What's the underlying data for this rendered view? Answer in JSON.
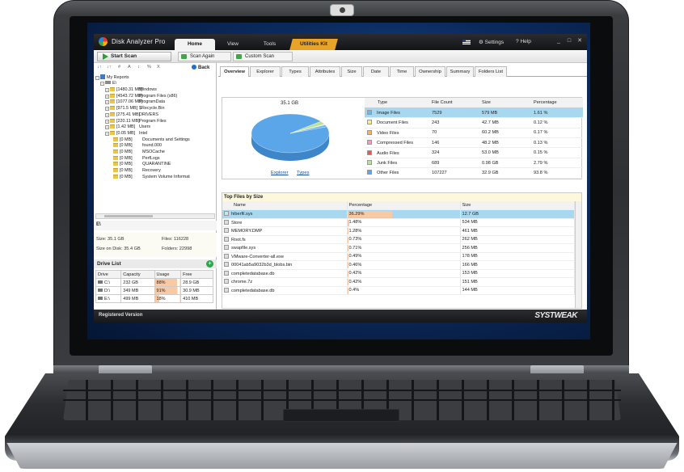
{
  "app": {
    "title": "Disk Analyzer Pro",
    "menu_tabs": [
      "Home",
      "View",
      "Tools",
      "Utilities Kit"
    ],
    "settings_label": "Settings",
    "help_label": "Help",
    "window_buttons": [
      "_",
      "□",
      "✕"
    ]
  },
  "toolbar": {
    "start_scan": "Start Scan",
    "scan_again": "Scan Again",
    "custom_scan": "Custom Scan"
  },
  "left": {
    "tools": [
      "↓↑",
      "↓↑",
      "#",
      "A",
      "↕",
      "%",
      "X"
    ],
    "back_label": "Back",
    "root_label": "My Reports",
    "root_drive": "E\\",
    "tree": [
      {
        "size": "[1480.31 MB]",
        "name": "Windows"
      },
      {
        "size": "[4543.72 MB]",
        "name": "Program Files (x86)"
      },
      {
        "size": "[1077.06 MB]",
        "name": "ProgramData"
      },
      {
        "size": "[971.5 MB]",
        "name": "$Recycle.Bin"
      },
      {
        "size": "[275.41 MB]",
        "name": "DRIVERS"
      },
      {
        "size": "[220.11 MB]",
        "name": "Program Files"
      },
      {
        "size": "[1.42 MB]",
        "name": "Users"
      },
      {
        "size": "[0.05 MB]",
        "name": "Intel"
      },
      {
        "size": "[0 MB]",
        "name": "Documents and Settings"
      },
      {
        "size": "[0 MB]",
        "name": "found.000"
      },
      {
        "size": "[0 MB]",
        "name": "MSOCache"
      },
      {
        "size": "[0 MB]",
        "name": "PerfLogs"
      },
      {
        "size": "[0 MB]",
        "name": "QUARANTINE"
      },
      {
        "size": "[0 MB]",
        "name": "Recovery"
      },
      {
        "size": "[0 MB]",
        "name": "System Volume Informat"
      }
    ],
    "path": "E\\",
    "size": "Size: 35.1 GB",
    "files": "Files: 116228",
    "size_on_disk": "Size on Disk: 35.4 GB",
    "folders": "Folders: 22998",
    "drive_list_title": "Drive List",
    "drive_headers": [
      "Drive",
      "Capacity",
      "Usage",
      "Free"
    ],
    "drives": [
      {
        "drive": "C:\\",
        "capacity": "232 GB",
        "usage": "88%",
        "usage_pct": 88,
        "free": "28.9 GB"
      },
      {
        "drive": "D:\\",
        "capacity": "349 MB",
        "usage": "91%",
        "usage_pct": 91,
        "free": "30.9 MB"
      },
      {
        "drive": "E:\\",
        "capacity": "499 MB",
        "usage": "18%",
        "usage_pct": 18,
        "free": "410 MB"
      }
    ]
  },
  "right": {
    "tabs": [
      "Overview",
      "Explorer",
      "Types",
      "Attributes",
      "Size",
      "Date",
      "Time",
      "Ownership",
      "Summary",
      "Folders List"
    ],
    "pie_total": "35.1 GB",
    "links": [
      "Explorer",
      "Types"
    ],
    "type_headers": [
      "Type",
      "File Count",
      "Size",
      "Percentage"
    ],
    "types": [
      {
        "type": "Image Files",
        "count": "7529",
        "size": "579 MB",
        "pct": "1.61 %",
        "pct_value": 1.61,
        "color": "#6fb6e6"
      },
      {
        "type": "Document Files",
        "count": "243",
        "size": "42.7 MB",
        "pct": "0.12 %",
        "pct_value": 0.12,
        "color": "#f3ee8c"
      },
      {
        "type": "Video Files",
        "count": "70",
        "size": "60.2 MB",
        "pct": "0.17 %",
        "pct_value": 0.17,
        "color": "#f4b55a"
      },
      {
        "type": "Compressed Files",
        "count": "146",
        "size": "48.2 MB",
        "pct": "0.13 %",
        "pct_value": 0.13,
        "color": "#f29ac0"
      },
      {
        "type": "Audio Files",
        "count": "324",
        "size": "53.0 MB",
        "pct": "0.15 %",
        "pct_value": 0.15,
        "color": "#e85656"
      },
      {
        "type": "Junk Files",
        "count": "689",
        "size": "0.98 GB",
        "pct": "2.79 %",
        "pct_value": 2.79,
        "color": "#b9e29a"
      },
      {
        "type": "Other Files",
        "count": "107227",
        "size": "32.9 GB",
        "pct": "93.8 %",
        "pct_value": 93.8,
        "color": "#5aa6e8"
      }
    ],
    "top_files_title": "Top Files by Size",
    "file_headers": [
      "Name",
      "Percentage",
      "Size"
    ],
    "files": [
      {
        "name": "hiberfil.sys",
        "pct": "36.29%",
        "pct_value": 36.29,
        "size": "12.7 GB"
      },
      {
        "name": "Store",
        "pct": "1.48%",
        "pct_value": 1.48,
        "size": "534 MB"
      },
      {
        "name": "MEMORY.DMP",
        "pct": "1.28%",
        "pct_value": 1.28,
        "size": "461 MB"
      },
      {
        "name": "Root.fs",
        "pct": "0.73%",
        "pct_value": 0.73,
        "size": "262 MB"
      },
      {
        "name": "swapfile.sys",
        "pct": "0.71%",
        "pct_value": 0.71,
        "size": "256 MB"
      },
      {
        "name": "VMware-Converter-all.exe",
        "pct": "0.49%",
        "pct_value": 0.49,
        "size": "178 MB"
      },
      {
        "name": "00041ab5a9032b3d_blobs.bin",
        "pct": "0.46%",
        "pct_value": 0.46,
        "size": "166 MB"
      },
      {
        "name": "completedatabase.db",
        "pct": "0.42%",
        "pct_value": 0.42,
        "size": "153 MB"
      },
      {
        "name": "chrome.7z",
        "pct": "0.42%",
        "pct_value": 0.42,
        "size": "151 MB"
      },
      {
        "name": "completedatabase.db",
        "pct": "0.4%",
        "pct_value": 0.4,
        "size": "144 MB"
      }
    ]
  },
  "status": "Registered Version",
  "brand": "SYSTWEAK"
}
